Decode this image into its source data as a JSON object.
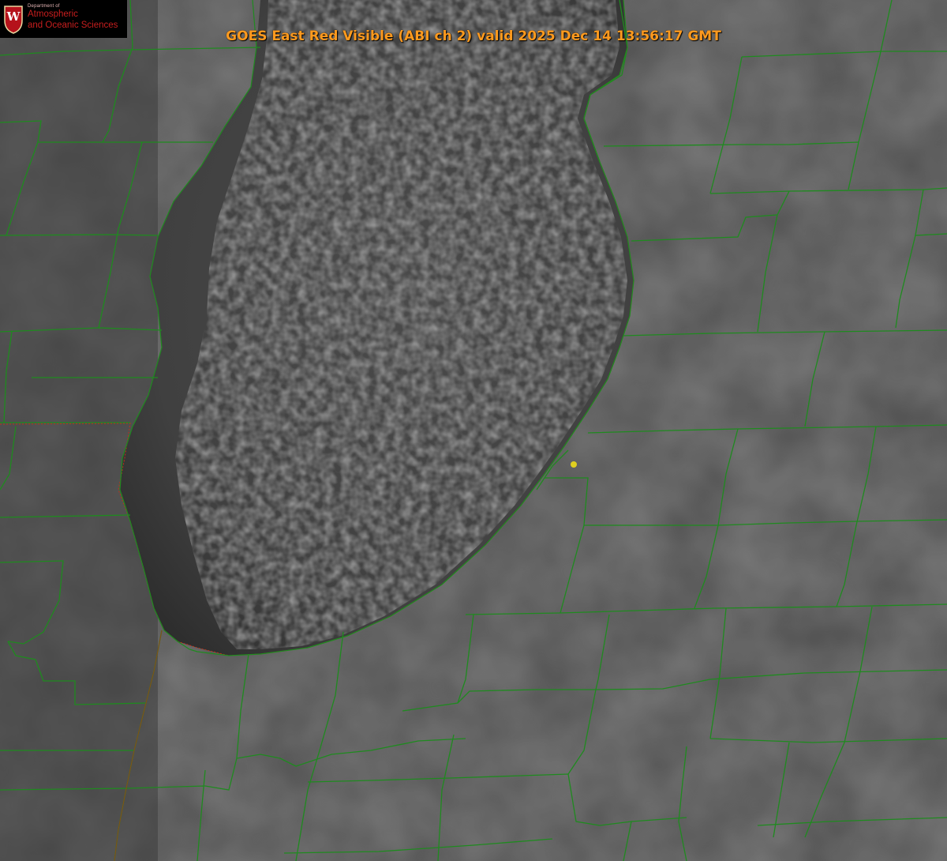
{
  "title": "GOES East Red Visible (ABI ch 2) valid 2025 Dec 14 13:56:17 GMT",
  "logo": {
    "line_small": "Department of",
    "line1": "Atmospheric",
    "line2": "and Oceanic Sciences",
    "seal_letter": "W",
    "seal_color": "#b5121b"
  },
  "colors": {
    "county_lines": "#1f8a1f",
    "state_line": "#c03018",
    "title": "#ff9a1e",
    "marker": "#e0d020",
    "land": "#555555",
    "lake": "#393939"
  },
  "map": {
    "features": [
      "lake-surface",
      "county-boundaries",
      "state-boundary",
      "location-marker"
    ]
  }
}
